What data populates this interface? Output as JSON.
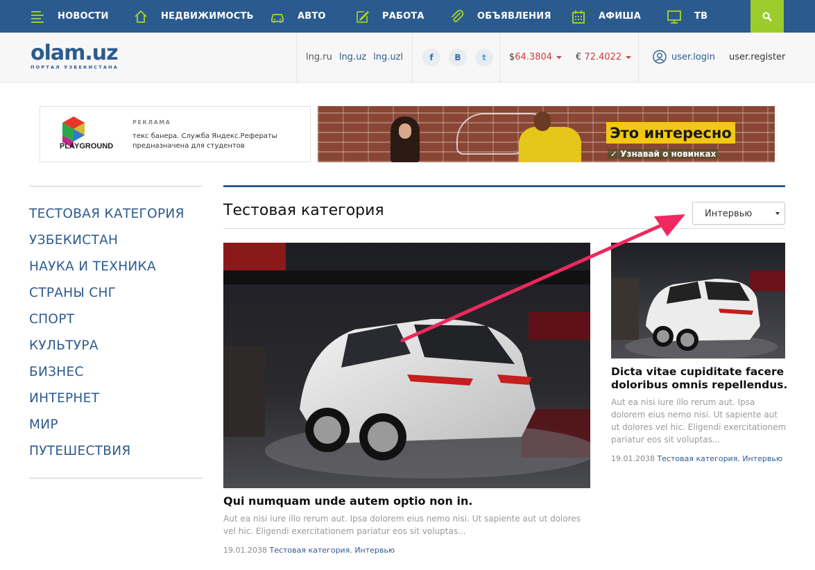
{
  "nav": {
    "items": [
      {
        "label": "НОВОСТИ",
        "icon": "menu-lines-icon"
      },
      {
        "label": "НЕДВИЖИМОСТЬ",
        "icon": "house-icon"
      },
      {
        "label": "АВТО",
        "icon": "car-icon"
      },
      {
        "label": "РАБОТА",
        "icon": "edit-icon"
      },
      {
        "label": "ОБЪЯВЛЕНИЯ",
        "icon": "paperclip-icon"
      },
      {
        "label": "АФИША",
        "icon": "calendar-icon"
      },
      {
        "label": "ТВ",
        "icon": "monitor-icon"
      }
    ],
    "search_icon": "search-icon"
  },
  "header": {
    "logo_text": "olam.uz",
    "logo_sub": "ПОРТАЛ УЗБЕКИСТАНА",
    "languages": [
      "lng.ru",
      "lng.uz",
      "lng.uzl"
    ],
    "social": [
      "f",
      "B",
      "t"
    ],
    "currency_usd": {
      "symbol": "$",
      "value": "64.3804"
    },
    "currency_eur": {
      "symbol": "€",
      "value": "72.4022"
    },
    "login": "user.login",
    "register": "user.register"
  },
  "ads": {
    "left": {
      "brand": "PLAYGROUND",
      "label": "РЕКЛАМА",
      "text": "текс банера. Служба Яндекс.Рефераты предназначена для студентов"
    },
    "right": {
      "headline": "Это интересно",
      "sub": "✓ Узнавай о новинках"
    }
  },
  "sidebar": {
    "items": [
      "ТЕСТОВАЯ КАТЕГОРИЯ",
      "УЗБЕКИСТАН",
      "НАУКА И ТЕХНИКА",
      "СТРАНЫ СНГ",
      "СПОРТ",
      "КУЛЬТУРА",
      "БИЗНЕС",
      "ИНТЕРНЕТ",
      "МИР",
      "ПУТЕШЕСТВИЯ"
    ]
  },
  "main": {
    "title": "Тестовая категория",
    "filter_value": "Интервью",
    "articles": [
      {
        "title": "Qui numquam unde autem optio non in.",
        "excerpt": "Aut ea nisi iure illo rerum aut. Ipsa dolorem eius nemo nisi. Ut sapiente aut ut dolores vel hic. Eligendi exercitationem pariatur eos sit voluptas...",
        "date": "19.01.2038",
        "cat1": "Тестовая категория",
        "cat2": "Интервью"
      },
      {
        "title": "Dicta vitae cupiditate facere doloribus omnis repellendus.",
        "excerpt": "Aut ea nisi iure illo rerum aut. Ipsa dolorem eius nemo nisi. Ut sapiente aut ut dolores vel hic. Eligendi exercitationem pariatur eos sit voluptas...",
        "date": "19.01.2038",
        "cat1": "Тестовая категория",
        "cat2": "Интервью"
      }
    ]
  },
  "colors": {
    "nav_bg": "#2b5a8e",
    "accent_green": "#9ccc2c",
    "link_blue": "#2c5b8e",
    "currency_red": "#d23b3b",
    "annotation_arrow": "#f0285f"
  }
}
